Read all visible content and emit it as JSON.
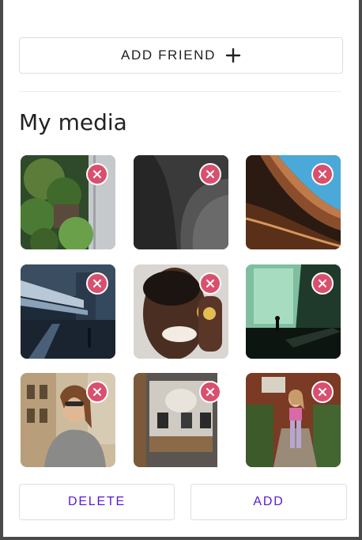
{
  "header": {
    "add_friend_label": "ADD FRIEND",
    "add_icon": "plus-icon"
  },
  "media": {
    "title": "My media",
    "items": [
      {
        "alt": "garden-photo",
        "remove_icon": "close-icon"
      },
      {
        "alt": "sand-dune-photo",
        "remove_icon": "close-icon"
      },
      {
        "alt": "architecture-photo",
        "remove_icon": "close-icon"
      },
      {
        "alt": "city-street-photo",
        "remove_icon": "close-icon"
      },
      {
        "alt": "portrait-man-photo",
        "remove_icon": "close-icon"
      },
      {
        "alt": "green-hall-photo",
        "remove_icon": "close-icon"
      },
      {
        "alt": "woman-city-photo",
        "remove_icon": "close-icon"
      },
      {
        "alt": "shop-window-photo",
        "remove_icon": "close-icon"
      },
      {
        "alt": "woman-stairs-photo",
        "remove_icon": "close-icon"
      }
    ]
  },
  "footer": {
    "delete_label": "DELETE",
    "add_label": "ADD"
  },
  "colors": {
    "accent": "#5a18d6",
    "remove_badge": "#d9506e"
  }
}
